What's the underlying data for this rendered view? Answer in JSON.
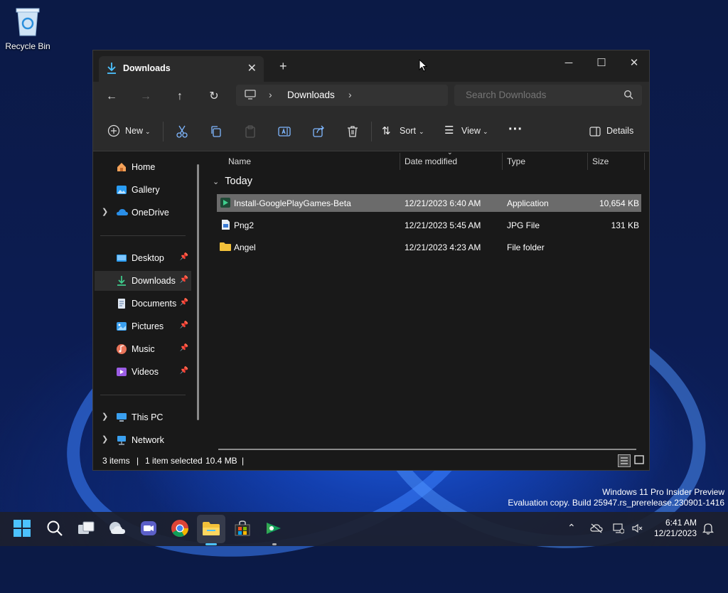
{
  "desktop": {
    "icons": [
      {
        "label": "Recycle Bin",
        "icon": "recycle-bin-icon"
      }
    ],
    "watermark": {
      "line1": "Windows 11 Pro Insider Preview",
      "line2": "Evaluation copy. Build 25947.rs_prerelease.230901-1416"
    }
  },
  "window": {
    "tab": {
      "label": "Downloads",
      "icon": "download-icon"
    },
    "controls": {
      "minimize": "─",
      "maximize": "☐",
      "close": "✕"
    },
    "address": {
      "crumb": "Downloads"
    },
    "search": {
      "placeholder": "Search Downloads"
    },
    "toolbar": {
      "new_label": "New",
      "sort_label": "Sort",
      "view_label": "View",
      "details_label": "Details"
    },
    "sidebar": {
      "quick": [
        {
          "label": "Home",
          "icon": "home-icon"
        },
        {
          "label": "Gallery",
          "icon": "gallery-icon"
        },
        {
          "label": "OneDrive",
          "icon": "cloud-icon"
        }
      ],
      "pinned": [
        {
          "label": "Desktop"
        },
        {
          "label": "Downloads"
        },
        {
          "label": "Documents"
        },
        {
          "label": "Pictures"
        },
        {
          "label": "Music"
        },
        {
          "label": "Videos"
        }
      ],
      "devices": [
        {
          "label": "This PC"
        },
        {
          "label": "Network"
        }
      ]
    },
    "columns": {
      "name": "Name",
      "date": "Date modified",
      "type": "Type",
      "size": "Size"
    },
    "group_label": "Today",
    "files": [
      {
        "name": "Install-GooglePlayGames-Beta",
        "date": "12/21/2023 6:40 AM",
        "type": "Application",
        "size": "10,654 KB",
        "selected": true
      },
      {
        "name": "Png2",
        "date": "12/21/2023 5:45 AM",
        "type": "JPG File",
        "size": "131 KB",
        "selected": false
      },
      {
        "name": "Angel",
        "date": "12/21/2023 4:23 AM",
        "type": "File folder",
        "size": "",
        "selected": false
      }
    ],
    "status": {
      "items": "3 items",
      "selected": "1 item selected",
      "size": "10.4 MB"
    }
  },
  "taskbar": {
    "clock": {
      "time": "6:41 AM",
      "date": "12/21/2023"
    }
  },
  "colors": {
    "accent": "#4cc2ff",
    "folder": "#f3c13a",
    "selection": "#6b6b6b"
  }
}
